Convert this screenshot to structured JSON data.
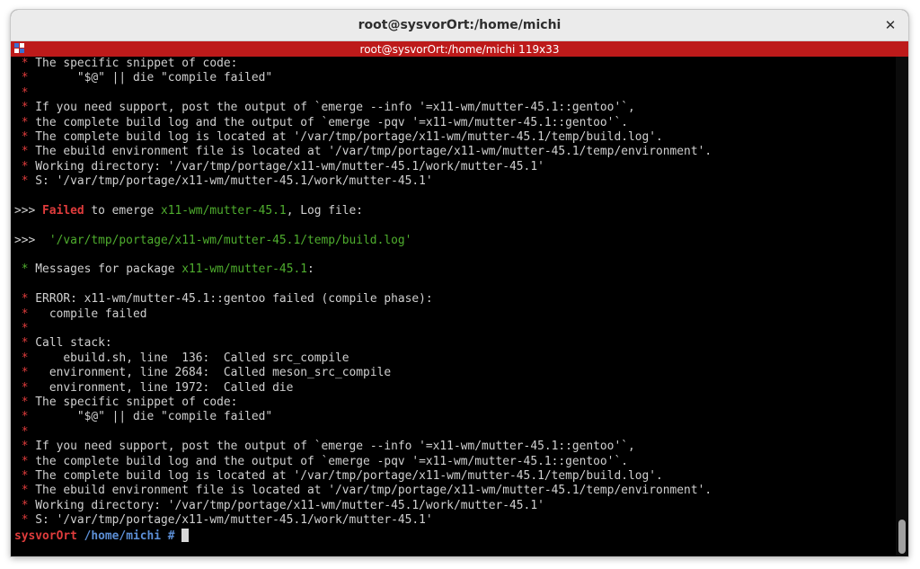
{
  "window": {
    "title": "root@sysvorOrt:/home/michi"
  },
  "tab": {
    "title": "root@sysvorOrt:/home/michi 119x33"
  },
  "icons": {
    "close": "close-icon",
    "tab": "terminal-tab-icon"
  },
  "colors": {
    "tabbar": "#bd1a1a",
    "error_star": "#e03c3c",
    "green_text": "#4fae2e",
    "prompt_host": "#e03c3c",
    "prompt_path": "#5c8fd6"
  },
  "lines": [
    [
      [
        "red",
        " * "
      ],
      [
        "",
        "The specific snippet of code:"
      ]
    ],
    [
      [
        "red",
        " * "
      ],
      [
        "",
        "      \"$@\" || die \"compile failed\""
      ]
    ],
    [
      [
        "red",
        " * "
      ]
    ],
    [
      [
        "red",
        " * "
      ],
      [
        "",
        "If you need support, post the output of `emerge --info '=x11-wm/mutter-45.1::gentoo'`,"
      ]
    ],
    [
      [
        "red",
        " * "
      ],
      [
        "",
        "the complete build log and the output of `emerge -pqv '=x11-wm/mutter-45.1::gentoo'`."
      ]
    ],
    [
      [
        "red",
        " * "
      ],
      [
        "",
        "The complete build log is located at '/var/tmp/portage/x11-wm/mutter-45.1/temp/build.log'."
      ]
    ],
    [
      [
        "red",
        " * "
      ],
      [
        "",
        "The ebuild environment file is located at '/var/tmp/portage/x11-wm/mutter-45.1/temp/environment'."
      ]
    ],
    [
      [
        "red",
        " * "
      ],
      [
        "",
        "Working directory: '/var/tmp/portage/x11-wm/mutter-45.1/work/mutter-45.1'"
      ]
    ],
    [
      [
        "red",
        " * "
      ],
      [
        "",
        "S: '/var/tmp/portage/x11-wm/mutter-45.1/work/mutter-45.1'"
      ]
    ],
    [],
    [
      [
        "",
        ">>> "
      ],
      [
        "red bold",
        "Failed"
      ],
      [
        "",
        " to emerge "
      ],
      [
        "green",
        "x11-wm/mutter-45.1"
      ],
      [
        "",
        ", Log file:"
      ]
    ],
    [],
    [
      [
        "",
        ">>>  "
      ],
      [
        "green",
        "'/var/tmp/portage/x11-wm/mutter-45.1/temp/build.log'"
      ]
    ],
    [],
    [
      [
        "green",
        " * "
      ],
      [
        "",
        "Messages for package "
      ],
      [
        "green",
        "x11-wm/mutter-45.1"
      ],
      [
        "",
        ":"
      ]
    ],
    [],
    [
      [
        "red",
        " * "
      ],
      [
        "",
        "ERROR: x11-wm/mutter-45.1::gentoo failed (compile phase):"
      ]
    ],
    [
      [
        "red",
        " * "
      ],
      [
        "",
        "  compile failed"
      ]
    ],
    [
      [
        "red",
        " * "
      ]
    ],
    [
      [
        "red",
        " * "
      ],
      [
        "",
        "Call stack:"
      ]
    ],
    [
      [
        "red",
        " * "
      ],
      [
        "",
        "    ebuild.sh, line  136:  Called src_compile"
      ]
    ],
    [
      [
        "red",
        " * "
      ],
      [
        "",
        "  environment, line 2684:  Called meson_src_compile"
      ]
    ],
    [
      [
        "red",
        " * "
      ],
      [
        "",
        "  environment, line 1972:  Called die"
      ]
    ],
    [
      [
        "red",
        " * "
      ],
      [
        "",
        "The specific snippet of code:"
      ]
    ],
    [
      [
        "red",
        " * "
      ],
      [
        "",
        "      \"$@\" || die \"compile failed\""
      ]
    ],
    [
      [
        "red",
        " * "
      ]
    ],
    [
      [
        "red",
        " * "
      ],
      [
        "",
        "If you need support, post the output of `emerge --info '=x11-wm/mutter-45.1::gentoo'`,"
      ]
    ],
    [
      [
        "red",
        " * "
      ],
      [
        "",
        "the complete build log and the output of `emerge -pqv '=x11-wm/mutter-45.1::gentoo'`."
      ]
    ],
    [
      [
        "red",
        " * "
      ],
      [
        "",
        "The complete build log is located at '/var/tmp/portage/x11-wm/mutter-45.1/temp/build.log'."
      ]
    ],
    [
      [
        "red",
        " * "
      ],
      [
        "",
        "The ebuild environment file is located at '/var/tmp/portage/x11-wm/mutter-45.1/temp/environment'."
      ]
    ],
    [
      [
        "red",
        " * "
      ],
      [
        "",
        "Working directory: '/var/tmp/portage/x11-wm/mutter-45.1/work/mutter-45.1'"
      ]
    ],
    [
      [
        "red",
        " * "
      ],
      [
        "",
        "S: '/var/tmp/portage/x11-wm/mutter-45.1/work/mutter-45.1'"
      ]
    ]
  ],
  "prompt": {
    "host": "sysvorOrt",
    "path": "/home/michi",
    "symbol": "#"
  }
}
